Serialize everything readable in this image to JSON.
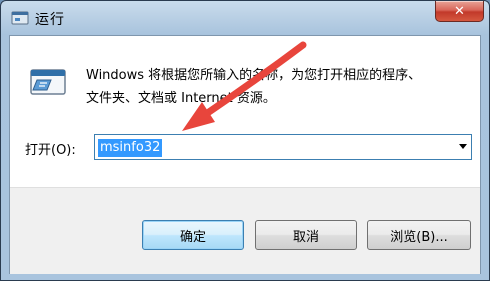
{
  "window": {
    "title": "运行",
    "close_glyph": "✕"
  },
  "description": {
    "line1": "Windows 将根据您所输入的名称，为您打开相应的程序、",
    "line2": "文件夹、文档或 Internet 资源。"
  },
  "open": {
    "label": "打开(O):",
    "value": "msinfo32"
  },
  "buttons": {
    "ok": "确定",
    "cancel": "取消",
    "browse": "浏览(B)..."
  },
  "colors": {
    "annotation_arrow": "#e8453c",
    "selection": "#3399ff",
    "close_button": "#c8432f"
  },
  "icons": [
    "run-program-icon",
    "close-icon",
    "dropdown-arrow-icon",
    "annotation-arrow-icon"
  ]
}
